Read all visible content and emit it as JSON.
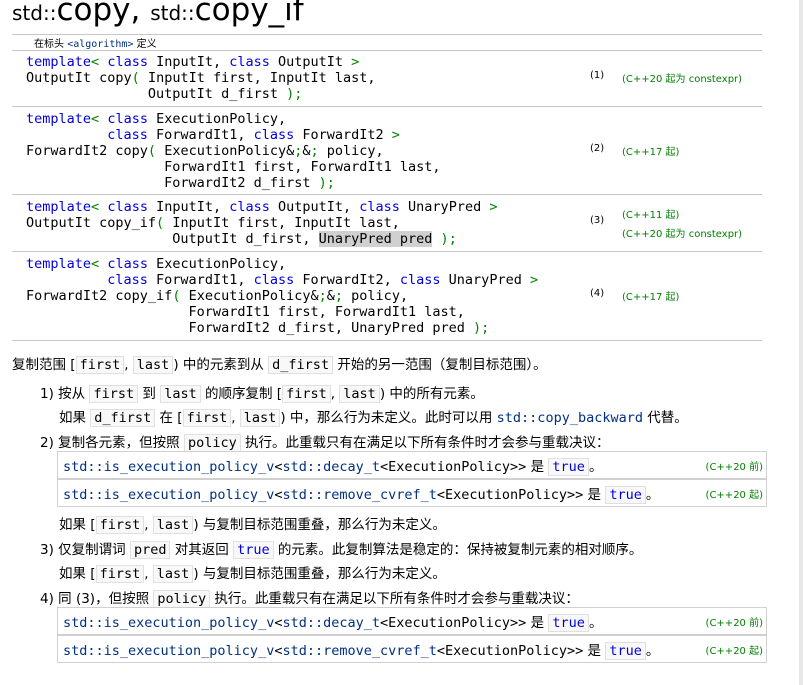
{
  "title": {
    "ns1": "std::",
    "name1": "copy",
    "sep": ", ",
    "ns2": "std::",
    "name2": "copy_if"
  },
  "header": {
    "prefix": "在标头 ",
    "file": "<algorithm>",
    "suffix": " 定义"
  },
  "decl1": {
    "code": "template< class InputIt, class OutputIt >\nOutputIt copy( InputIt first, InputIt last,\n               OutputIt d_first );",
    "num": "(1)",
    "note": "(C++20 起为 constexpr)"
  },
  "decl2": {
    "code": "template< class ExecutionPolicy,\n          class ForwardIt1, class ForwardIt2 >\nForwardIt2 copy( ExecutionPolicy&& policy,\n                 ForwardIt1 first, ForwardIt1 last,\n                 ForwardIt2 d_first );",
    "num": "(2)",
    "note": "(C++17 起)"
  },
  "decl3": {
    "code1": "template< class InputIt, class OutputIt, class UnaryPred >\nOutputIt copy_if( InputIt first, InputIt last,\n                  OutputIt d_first, ",
    "hl": "UnaryPred pred",
    "code2": " );",
    "num": "(3)",
    "note1": "(C++11 起)",
    "note2": "(C++20 起为 constexpr)"
  },
  "decl4": {
    "code": "template< class ExecutionPolicy,\n          class ForwardIt1, class ForwardIt2, class UnaryPred >\nForwardIt2 copy_if( ExecutionPolicy&& policy,\n                    ForwardIt1 first, ForwardIt1 last,\n                    ForwardIt2 d_first, UnaryPred pred );",
    "num": "(4)",
    "note": "(C++17 起)"
  },
  "intro": {
    "t1": "复制范围 [",
    "first": "first",
    "comma": ",",
    "last": "last",
    "t2": ") 中的元素到从 ",
    "dfirst": "d_first",
    "t3": " 开始的另一范围（复制目标范围）。"
  },
  "item1": {
    "label": "1)",
    "t1": " 按从 ",
    "first": "first",
    "to": " 到 ",
    "last": "last",
    "t2": " 的顺序复制 [",
    "first2": "first",
    "comma": ",",
    "last2": "last",
    "t3": ") 中的所有元素。",
    "s1": "如果 ",
    "dfirst": "d_first",
    "s2": " 在 [",
    "first3": "first",
    "comma2": ",",
    "last3": "last",
    "s3": ") 中，那么行为未定义。此时可以用 ",
    "link": "std::copy_backward",
    "s4": " 代替。"
  },
  "item2": {
    "label": "2)",
    "text1": " 复制各元素，但按照 ",
    "policy": "policy",
    "text2": " 执行。此重载只有在满足以下所有条件时才会参与重载决议：",
    "cond1": {
      "expr_a": "std::is_execution_policy_v",
      "lt": "<",
      "expr_b": "std::decay_t",
      "arg": "<ExecutionPolicy>>",
      "is": " 是 ",
      "val": "true",
      "end": "。",
      "ver": "(C++20 前)"
    },
    "cond2": {
      "expr_a": "std::is_execution_policy_v",
      "lt": "<",
      "expr_b": "std::remove_cvref_t",
      "arg": "<ExecutionPolicy>>",
      "is": " 是 ",
      "val": "true",
      "end": "。",
      "ver": "(C++20 起)"
    },
    "after": {
      "t1": "如果 [",
      "first": "first",
      "comma": ",",
      "last": "last",
      "t2": ") 与复制目标范围重叠，那么行为未定义。"
    }
  },
  "item3": {
    "label": "3)",
    "t1": " 仅复制谓词 ",
    "pred": "pred",
    "t2": " 对其返回 ",
    "true": "true",
    "t3": " 的元素。此复制算法是稳定的：保持被复制元素的相对顺序。",
    "after": {
      "t1": "如果 [",
      "first": "first",
      "comma": ",",
      "last": "last",
      "t2": ") 与复制目标范围重叠，那么行为未定义。"
    }
  },
  "item4": {
    "label": "4)",
    "text1": " 同 (3)，但按照 ",
    "policy": "policy",
    "text2": " 执行。此重载只有在满足以下所有条件时才会参与重载决议：",
    "cond1": {
      "expr_a": "std::is_execution_policy_v",
      "lt": "<",
      "expr_b": "std::decay_t",
      "arg": "<ExecutionPolicy>>",
      "is": " 是 ",
      "val": "true",
      "end": "。",
      "ver": "(C++20 前)"
    },
    "cond2": {
      "expr_a": "std::is_execution_policy_v",
      "lt": "<",
      "expr_b": "std::remove_cvref_t",
      "arg": "<ExecutionPolicy>>",
      "is": " 是 ",
      "val": "true",
      "end": "。",
      "ver": "(C++20 起)"
    }
  }
}
